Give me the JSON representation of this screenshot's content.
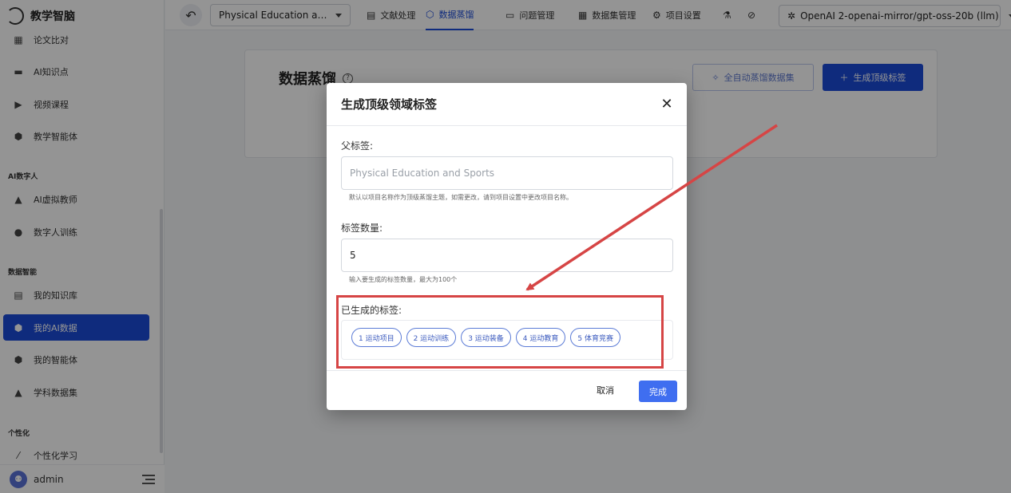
{
  "brand": {
    "name": "教学智脑"
  },
  "sidebar": {
    "items": [
      {
        "label": "论文比对",
        "icon": "compare-icon",
        "glyph": "▦"
      },
      {
        "label": "AI知识点",
        "icon": "clapper-icon",
        "glyph": "▬"
      },
      {
        "label": "视频课程",
        "icon": "video-icon",
        "glyph": "▶"
      },
      {
        "label": "教学智能体",
        "icon": "cube-icon",
        "glyph": "⬢"
      },
      {
        "label": "AI虚拟教师",
        "icon": "teacher-icon",
        "glyph": "▲"
      },
      {
        "label": "数字人训练",
        "icon": "person-icon",
        "glyph": "●"
      },
      {
        "label": "我的知识库",
        "icon": "library-icon",
        "glyph": "▤"
      },
      {
        "label": "我的AI数据",
        "icon": "data-cube-icon",
        "glyph": "⬢"
      },
      {
        "label": "我的智能体",
        "icon": "agent-icon",
        "glyph": "⬢"
      },
      {
        "label": "学科数据集",
        "icon": "graduation-cap-icon",
        "glyph": "▲"
      },
      {
        "label": "个性化学习",
        "icon": "wand-icon",
        "glyph": "⁄"
      }
    ],
    "sections": [
      "AI数字人",
      "数据智能",
      "个性化"
    ],
    "user": {
      "name": "admin",
      "avatar_glyph": "⚉"
    }
  },
  "topbar": {
    "project": "Physical Education and ...",
    "tabs": [
      {
        "label": "文献处理",
        "glyph": "▤"
      },
      {
        "label": "数据蒸馏",
        "glyph": "⬡"
      },
      {
        "label": "问题管理",
        "glyph": "▭"
      },
      {
        "label": "数据集管理",
        "glyph": "▦"
      },
      {
        "label": "项目设置",
        "glyph": "⚙"
      }
    ],
    "extra_icons": [
      {
        "name": "flask-icon",
        "glyph": "⚗"
      },
      {
        "name": "check-circle-icon",
        "glyph": "⊘"
      }
    ],
    "model": "OpenAI 2-openai-mirror/gpt-oss-20b (llm)"
  },
  "page": {
    "title": "数据蒸馏",
    "auto_button": "全自动蒸馏数据集",
    "generate_button": "生成顶级标签"
  },
  "dialog": {
    "title": "生成顶级领域标签",
    "parent_label": "父标签:",
    "parent_placeholder": "Physical Education and Sports",
    "parent_helper": "默认以项目名称作为顶级蒸馏主题，如需更改，请到项目设置中更改项目名称。",
    "count_label": "标签数量:",
    "count_value": "5",
    "count_helper": "输入要生成的标签数量，最大为100个",
    "generated_label": "已生成的标签:",
    "tags": [
      "1 运动项目",
      "2 运动训练",
      "3 运动装备",
      "4 运动教育",
      "5 体育竞赛"
    ],
    "cancel": "取消",
    "done": "完成"
  },
  "colors": {
    "primary": "#1b4bd8",
    "done_button": "#3f6ef0",
    "annotation": "#d64545",
    "overlay": "rgba(0,0,0,0.42)"
  }
}
